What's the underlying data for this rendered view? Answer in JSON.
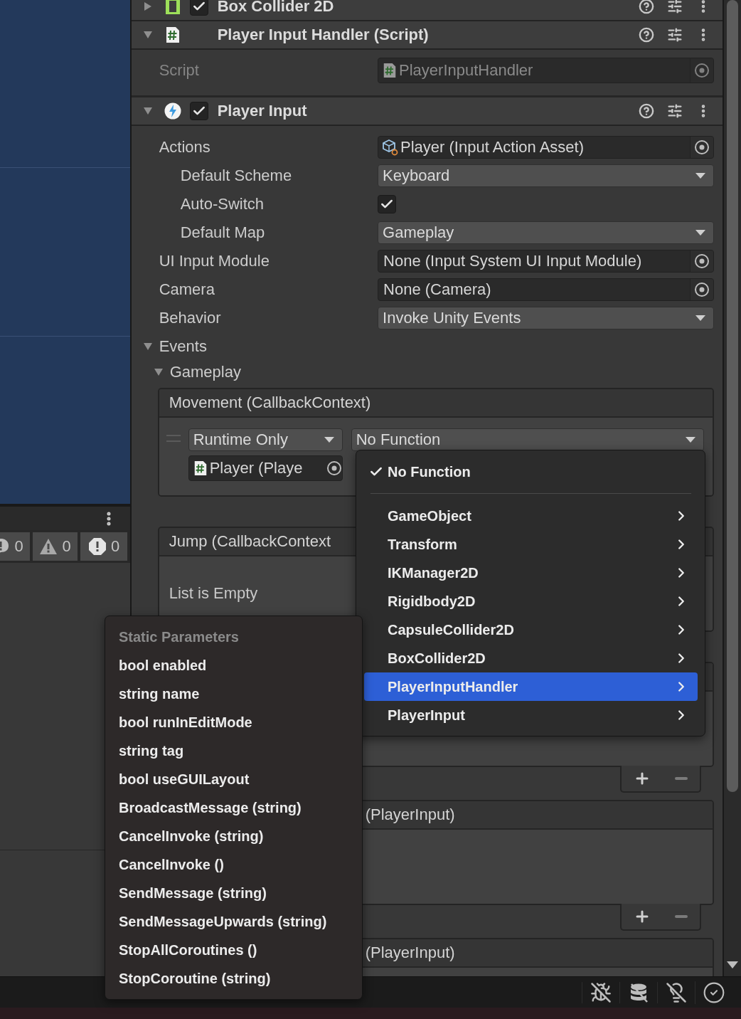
{
  "console": {
    "counts": [
      {
        "kind": "message",
        "value": "0"
      },
      {
        "kind": "warning",
        "value": "0"
      },
      {
        "kind": "error",
        "value": "0"
      }
    ]
  },
  "components": [
    {
      "kind": "collider",
      "title": "Box Collider 2D",
      "expanded": false,
      "enabled": true
    },
    {
      "kind": "script",
      "title": "Player Input Handler (Script)",
      "expanded": true
    },
    {
      "kind": "input",
      "title": "Player Input",
      "expanded": true,
      "enabled": true
    }
  ],
  "script_field": {
    "label": "Script",
    "value": "PlayerInputHandler"
  },
  "properties": [
    {
      "kind": "asset",
      "label": "Actions",
      "value": "Player (Input Action Asset)",
      "children": [
        {
          "kind": "dropdown",
          "label": "Default Scheme",
          "value": "Keyboard"
        },
        {
          "kind": "checkbox",
          "label": "Auto-Switch",
          "checked": true
        },
        {
          "kind": "dropdown",
          "label": "Default Map",
          "value": "Gameplay"
        }
      ]
    },
    {
      "kind": "object",
      "label": "UI Input Module",
      "value": "None (Input System UI Input Module)"
    },
    {
      "kind": "object",
      "label": "Camera",
      "value": "None (Camera)"
    },
    {
      "kind": "dropdown",
      "label": "Behavior",
      "value": "Invoke Unity Events"
    }
  ],
  "events": {
    "label": "Events",
    "expanded": true,
    "children": [
      {
        "label": "Gameplay",
        "expanded": true
      }
    ]
  },
  "event_lists": [
    {
      "kind": "entry",
      "header": "Movement (CallbackContext)",
      "footer": false,
      "mode": "Runtime Only",
      "function": "No Function",
      "target": "Player (Playe"
    },
    {
      "kind": "empty",
      "header": "Jump (CallbackContext",
      "empty_text": "List is Empty",
      "footer": false
    },
    {
      "kind": "blank",
      "footer": true
    },
    {
      "kind": "partial",
      "header": "(PlayerInput)",
      "footer": true
    },
    {
      "kind": "partial",
      "header": "(PlayerInput)",
      "footer": false
    }
  ],
  "function_menu": {
    "items": [
      {
        "label": "No Function",
        "selected": true,
        "highlighted": false,
        "submenu": false
      },
      {
        "label": "GameObject",
        "selected": false,
        "highlighted": false,
        "submenu": true
      },
      {
        "label": "Transform",
        "selected": false,
        "highlighted": false,
        "submenu": true
      },
      {
        "label": "IKManager2D",
        "selected": false,
        "highlighted": false,
        "submenu": true
      },
      {
        "label": "Rigidbody2D",
        "selected": false,
        "highlighted": false,
        "submenu": true
      },
      {
        "label": "CapsuleCollider2D",
        "selected": false,
        "highlighted": false,
        "submenu": true
      },
      {
        "label": "BoxCollider2D",
        "selected": false,
        "highlighted": false,
        "submenu": true
      },
      {
        "label": "PlayerInputHandler",
        "selected": false,
        "highlighted": true,
        "submenu": true
      },
      {
        "label": "PlayerInput",
        "selected": false,
        "highlighted": false,
        "submenu": true
      }
    ]
  },
  "static_menu": {
    "title": "Static Parameters",
    "items": [
      "bool enabled",
      "string name",
      "bool runInEditMode",
      "string tag",
      "bool useGUILayout",
      "BroadcastMessage (string)",
      "CancelInvoke (string)",
      "CancelInvoke ()",
      "SendMessage (string)",
      "SendMessageUpwards (string)",
      "StopAllCoroutines ()",
      "StopCoroutine (string)"
    ]
  }
}
